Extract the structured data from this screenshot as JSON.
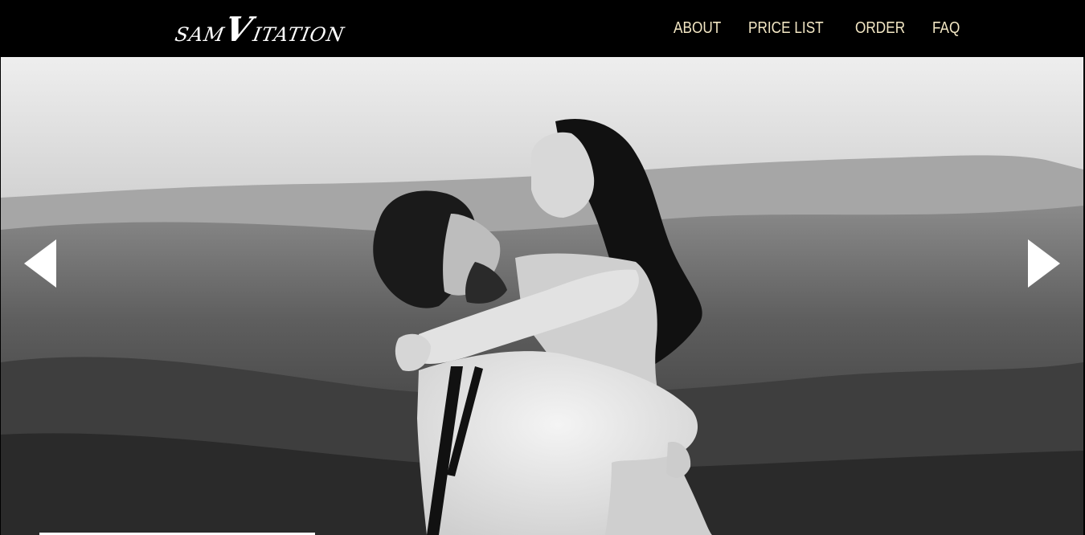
{
  "brand": {
    "logo_part1": "SAM",
    "logo_part2": "V",
    "logo_part3": "ITATION"
  },
  "nav": {
    "items": [
      {
        "label": "ABOUT"
      },
      {
        "label": "PRICE LIST"
      },
      {
        "label": "ORDER"
      },
      {
        "label": "FAQ"
      }
    ]
  },
  "hero": {
    "icons": {
      "prev": "chevron-left-icon",
      "next": "chevron-right-icon"
    }
  },
  "colors": {
    "header_bg": "#000000",
    "nav_text": "#f3e7c4",
    "logo_text": "#ffffff",
    "arrow": "#ffffff"
  }
}
